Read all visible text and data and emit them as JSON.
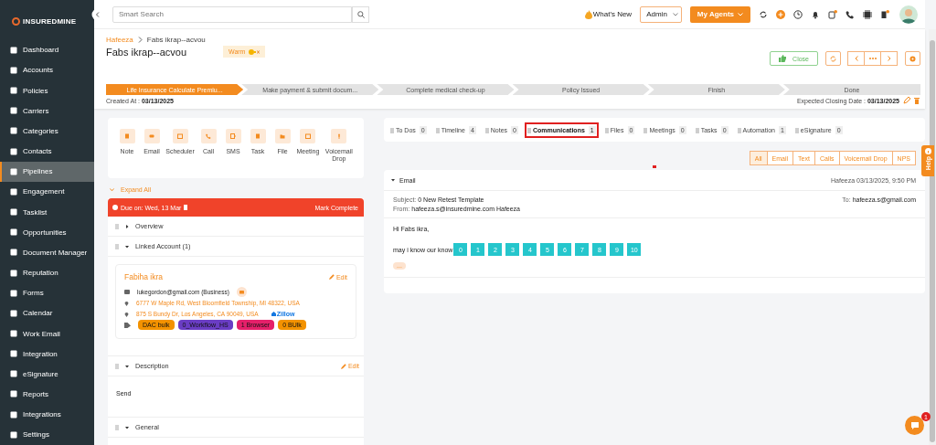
{
  "brand": {
    "name_bold": "INSUREDMINE"
  },
  "sidebar": {
    "items": [
      {
        "label": "Dashboard",
        "selected": false
      },
      {
        "label": "Accounts",
        "selected": false
      },
      {
        "label": "Policies",
        "selected": false
      },
      {
        "label": "Carriers",
        "selected": false
      },
      {
        "label": "Categories",
        "selected": false
      },
      {
        "label": "Contacts",
        "selected": false
      },
      {
        "label": "Pipelines",
        "selected": true
      },
      {
        "label": "Engagement",
        "selected": false
      },
      {
        "label": "Tasklist",
        "selected": false
      },
      {
        "label": "Opportunities",
        "selected": false
      },
      {
        "label": "Document Manager",
        "selected": false
      },
      {
        "label": "Reputation",
        "selected": false
      },
      {
        "label": "Forms",
        "selected": false
      },
      {
        "label": "Calendar",
        "selected": false
      },
      {
        "label": "Work Email",
        "selected": false
      },
      {
        "label": "Integration",
        "selected": false
      },
      {
        "label": "eSignature",
        "selected": false
      },
      {
        "label": "Reports",
        "selected": false
      },
      {
        "label": "Integrations",
        "selected": false
      },
      {
        "label": "Settings",
        "selected": false
      }
    ]
  },
  "topbar": {
    "search": {
      "placeholder": "Smart Search"
    },
    "whats_new": "What's New",
    "role": "Admin",
    "agents_button": "My Agents"
  },
  "record": {
    "breadcrumb": [
      "Hafeeza",
      "Fabs ikrap--acvou"
    ],
    "title": "Fabs ikrap--acvou",
    "temperature": "Warm",
    "close_button": "Close",
    "stages": [
      {
        "label": "Life Insurance Calculate Premiu...",
        "selected": true
      },
      {
        "label": "Make payment & submit docum...",
        "selected": false
      },
      {
        "label": "Complete medical check-up",
        "selected": false
      },
      {
        "label": "Policy Issued",
        "selected": false
      },
      {
        "label": "Finish",
        "selected": false
      },
      {
        "label": "Done",
        "selected": false
      }
    ],
    "created_label": "Created At :",
    "created_date": "03/13/2025",
    "closing_label": "Expected Closing Date :",
    "closing_date": "03/13/2025"
  },
  "actions": [
    {
      "label": "Note"
    },
    {
      "label": "Email"
    },
    {
      "label": "Scheduler"
    },
    {
      "label": "Call"
    },
    {
      "label": "SMS"
    },
    {
      "label": "Task"
    },
    {
      "label": "File"
    },
    {
      "label": "Meeting"
    },
    {
      "label": "Voicemail Drop"
    }
  ],
  "left_panel": {
    "expand_all": "Expand All",
    "due": "Due on: Wed, 13 Mar",
    "mark_complete": "Mark Complete",
    "sections": [
      {
        "title": "Overview",
        "expanded": false
      },
      {
        "title": "Linked Account (1)",
        "expanded": true
      }
    ],
    "account": {
      "name": "Fabiha ikra",
      "edit": "Edit",
      "email": "lukegordon@gmail.com (Business)",
      "addresses": [
        "6777 W Maple Rd, West Bloomfield Township, MI 48322, USA",
        "875 S Bundy Dr, Los Angeles, CA 90049, USA"
      ],
      "zillow": "Zillow",
      "tags": [
        {
          "label": "DAC bulk",
          "color": "#f39200"
        },
        {
          "label": "0_Workflow_HS",
          "color": "#6a3dc4"
        },
        {
          "label": "1 Browser",
          "color": "#e5206a"
        },
        {
          "label": "0 BUlk",
          "color": "#f39200"
        }
      ]
    },
    "description": {
      "title": "Description",
      "edit": "Edit",
      "text": "Send"
    },
    "general": {
      "title": "General"
    }
  },
  "tabs": [
    {
      "label": "To Dos",
      "count": "0",
      "selected": false
    },
    {
      "label": "Timeline",
      "count": "4",
      "selected": false
    },
    {
      "label": "Notes",
      "count": "0",
      "selected": false
    },
    {
      "label": "Communications",
      "count": "1",
      "selected": true
    },
    {
      "label": "Files",
      "count": "0",
      "selected": false
    },
    {
      "label": "Meetings",
      "count": "0",
      "selected": false
    },
    {
      "label": "Tasks",
      "count": "0",
      "selected": false
    },
    {
      "label": "Automation",
      "count": "1",
      "selected": false
    },
    {
      "label": "eSignature",
      "count": "0",
      "selected": false
    }
  ],
  "filters": [
    {
      "label": "All",
      "selected": true
    },
    {
      "label": "Email",
      "selected": false
    },
    {
      "label": "Text",
      "selected": false
    },
    {
      "label": "Calls",
      "selected": false
    },
    {
      "label": "Voicemail Drop",
      "selected": false
    },
    {
      "label": "NPS",
      "selected": false
    }
  ],
  "email": {
    "title": "Email",
    "meta": "Hafeeza 03/13/2025, 9:50 PM",
    "subject_label": "Subject:",
    "subject": "0 New Retest Template",
    "from_label": "From:",
    "from": "hafeeza.s@insuredmine.com Hafeeza",
    "to_label": "To:",
    "to": "hafeeza.s@gmail.com",
    "greeting": "Hi Fabs ikra,",
    "question": "may i know our know",
    "scale": [
      "0",
      "1",
      "2",
      "3",
      "4",
      "5",
      "6",
      "7",
      "8",
      "9",
      "10"
    ],
    "more": "..."
  },
  "help": "Help",
  "chat_badge": "1"
}
